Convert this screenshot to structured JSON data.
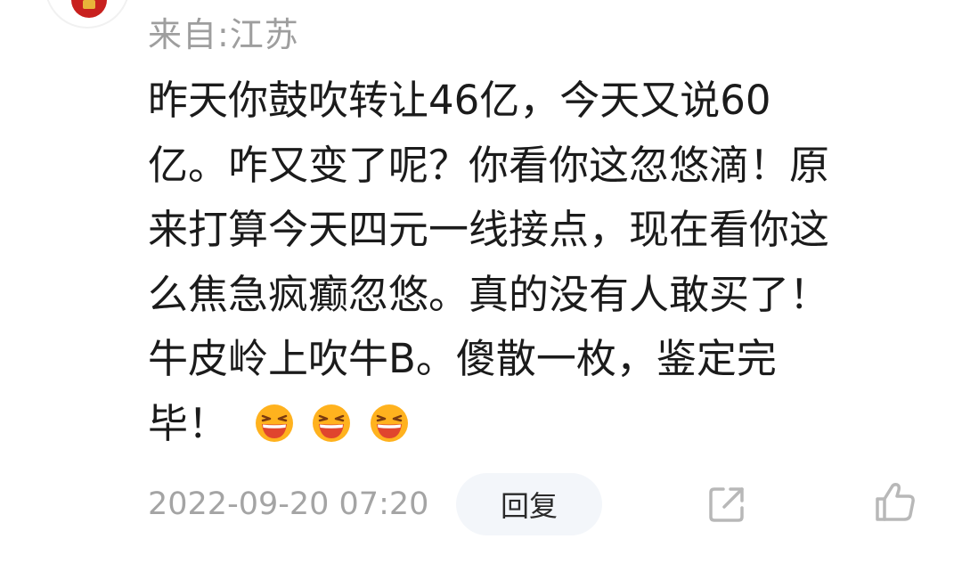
{
  "comment": {
    "location": "来自:江苏",
    "lines": [
      "昨天你鼓吹转让46亿，今天又说60",
      "亿。咋又变了呢？你看你这忽悠滴！原",
      "来打算今天四元一线接点，现在看你这",
      "么焦急疯癫忽悠。真的没有人敢买了！",
      "牛皮岭上吹牛B。傻散一枚，鉴定完",
      "毕！"
    ],
    "emojis": [
      "laughing-emoji",
      "laughing-emoji",
      "laughing-emoji"
    ],
    "timestamp": "2022-09-20 07:20",
    "reply_label": "回复"
  },
  "colors": {
    "text": "#1b1b1b",
    "meta": "#9e9e9e",
    "reply_bg": "#f3f6fa",
    "icon": "#b8b8b8",
    "emoji_face": "#ffb21e",
    "emoji_mouth": "#e0452e"
  },
  "icons": {
    "share": "share-icon",
    "like": "thumbs-up-icon"
  }
}
